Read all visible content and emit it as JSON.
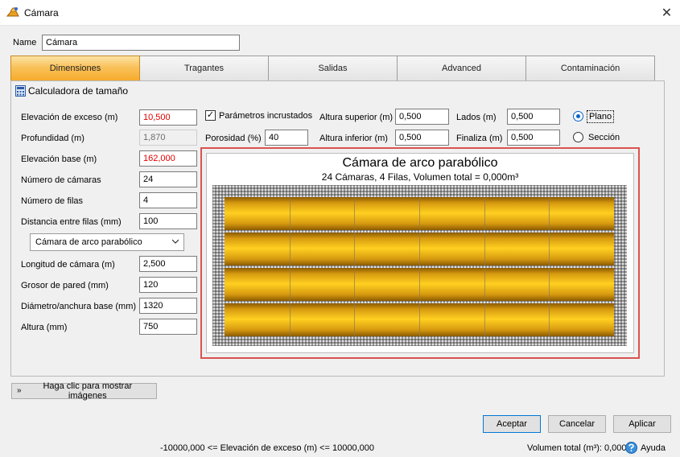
{
  "window": {
    "title": "Cámara",
    "close_glyph": "✕"
  },
  "name_row": {
    "label": "Name",
    "value": "Cámara"
  },
  "tabs": [
    {
      "label": "Dimensiones",
      "active": true
    },
    {
      "label": "Tragantes",
      "active": false
    },
    {
      "label": "Salidas",
      "active": false
    },
    {
      "label": "Advanced",
      "active": false
    },
    {
      "label": "Contaminación",
      "active": false
    }
  ],
  "section": {
    "title": "Calculadora de tamaño",
    "icon": "calculator-icon"
  },
  "left_fields": {
    "elevacion_exceso": {
      "label": "Elevación de exceso (m)",
      "value": "10,500",
      "color": "#e00000"
    },
    "profundidad": {
      "label": "Profundidad (m)",
      "value": "1,870"
    },
    "elevacion_base": {
      "label": "Elevación base (m)",
      "value": "162,000",
      "color": "#e00000"
    },
    "numero_camaras": {
      "label": "Número de cámaras",
      "value": "24"
    },
    "numero_filas": {
      "label": "Número de filas",
      "value": "4"
    },
    "distancia_filas": {
      "label": "Distancia entre filas (mm)",
      "value": "100"
    },
    "chamber_type": {
      "selected": "Cámara de arco parabólico"
    },
    "longitud_camara": {
      "label": "Longitud de cámara (m)",
      "value": "2,500"
    },
    "grosor_pared": {
      "label": "Grosor de pared (mm)",
      "value": "120"
    },
    "diametro_base": {
      "label": "Diámetro/anchura base (mm)",
      "value": "1320"
    },
    "altura": {
      "label": "Altura (mm)",
      "value": "750"
    }
  },
  "middle_fields": {
    "parametros_incrustados": {
      "label": "Parámetros incrustados",
      "checked": true,
      "glyph": "✓"
    },
    "porosidad": {
      "label": "Porosidad (%)",
      "value": "40"
    },
    "altura_superior": {
      "label": "Altura superior (m)",
      "value": "0,500"
    },
    "altura_inferior": {
      "label": "Altura inferior (m)",
      "value": "0,500"
    },
    "lados": {
      "label": "Lados (m)",
      "value": "0,500"
    },
    "finaliza": {
      "label": "Finaliza (m)",
      "value": "0,500"
    }
  },
  "view_mode": {
    "plano": {
      "label": "Plano",
      "selected": true
    },
    "seccion": {
      "label": "Sección",
      "selected": false
    }
  },
  "preview": {
    "title": "Cámara de arco parabólico",
    "subtitle": "24 Cámaras, 4 Filas, Volumen total = 0,000m³",
    "rows": 4,
    "columns": 6,
    "chamber_color": "#ffd020",
    "frame_color": "#d9534f"
  },
  "show_images_button": {
    "label": "Haga clic para mostrar imágenes",
    "icon": "double-chevron-down-icon"
  },
  "buttons": {
    "accept": "Aceptar",
    "cancel": "Cancelar",
    "apply": "Aplicar"
  },
  "status": {
    "range": "-10000,000 <= Elevación de exceso (m) <= 10000,000",
    "volume": "Volumen total (m³): 0,000",
    "help": "Ayuda"
  }
}
